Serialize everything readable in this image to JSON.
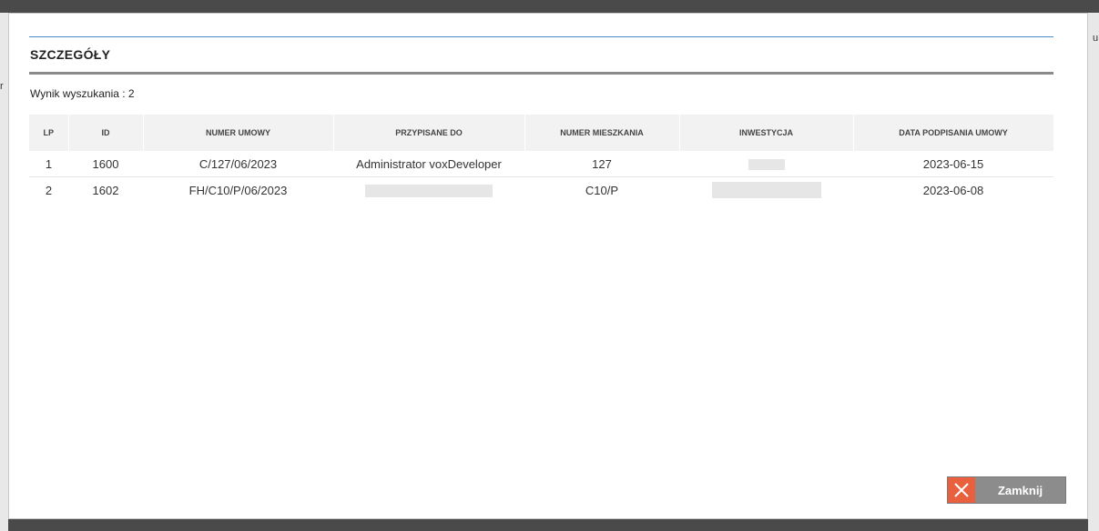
{
  "background": {
    "peek_left": "r",
    "peek_right": "u"
  },
  "dialog": {
    "title": "SZCZEGÓŁY",
    "result_label": "Wynik wyszukania : 2",
    "accent_color": "#4a8cc7",
    "close_button_color": "#e9603f"
  },
  "table": {
    "headers": [
      "LP",
      "ID",
      "NUMER UMOWY",
      "PRZYPISANE DO",
      "NUMER MIESZKANIA",
      "INWESTYCJA",
      "DATA PODPISANIA UMOWY"
    ],
    "rows": [
      {
        "lp": "1",
        "id": "1600",
        "numer_umowy": "C/127/06/2023",
        "przypisane_do": "Administrator voxDeveloper",
        "numer_mieszkania": "127",
        "inwestycja": "",
        "data": "2023-06-15"
      },
      {
        "lp": "2",
        "id": "1602",
        "numer_umowy": "FH/C10/P/06/2023",
        "przypisane_do": "",
        "numer_mieszkania": "C10/P",
        "inwestycja": "",
        "data": "2023-06-08"
      }
    ]
  },
  "footer": {
    "close_label": "Zamknij",
    "close_icon": "close-icon"
  }
}
